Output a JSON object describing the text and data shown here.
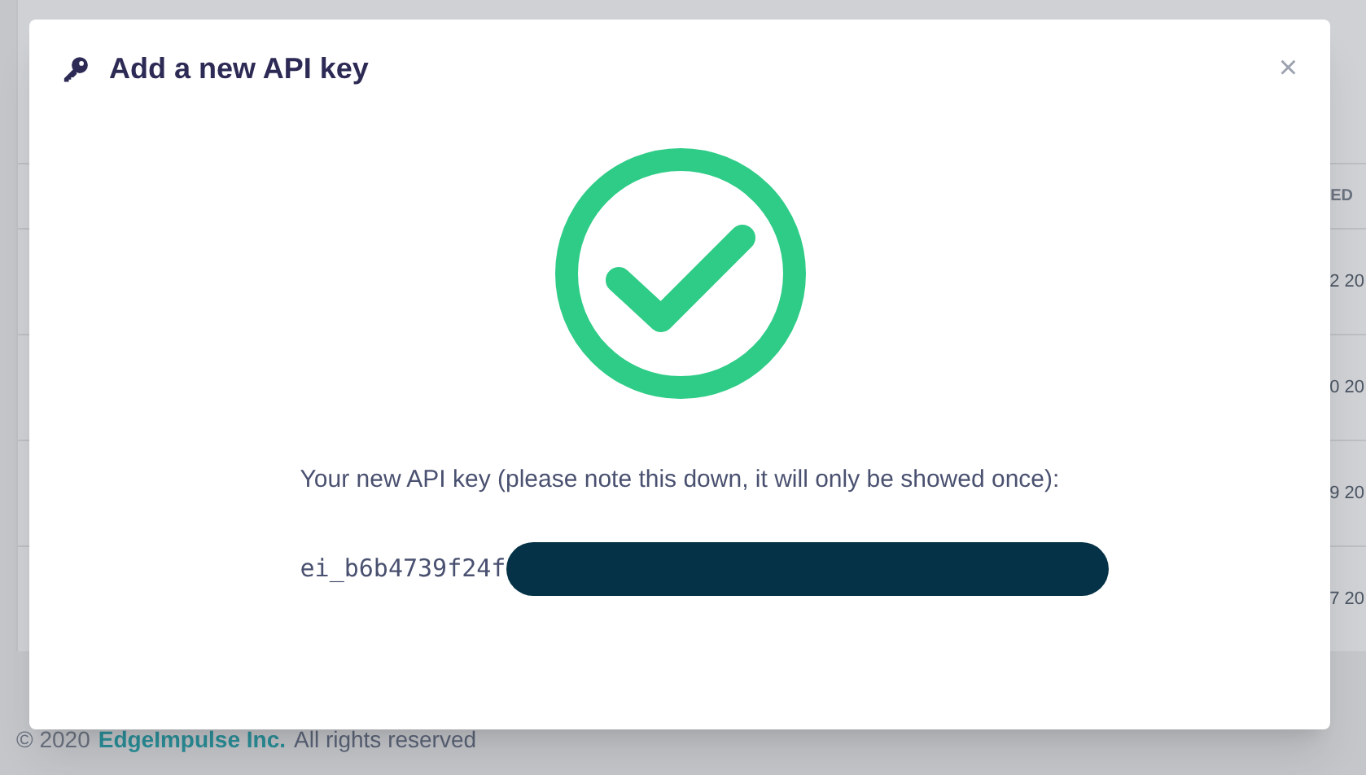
{
  "background_table": {
    "column_header": "ED",
    "rows": [
      "2 20",
      "0 20",
      "9 20",
      "7 20"
    ]
  },
  "footer": {
    "copyright": "© 2020",
    "company_link": "EdgeImpulse Inc.",
    "rights": "All rights reserved"
  },
  "dialog": {
    "title": "Add a new API key",
    "close": "×",
    "message": "Your new API key (please note this down, it will only be showed once):",
    "api_key_visible": "ei_b6b4739f24f",
    "redacted": true
  }
}
